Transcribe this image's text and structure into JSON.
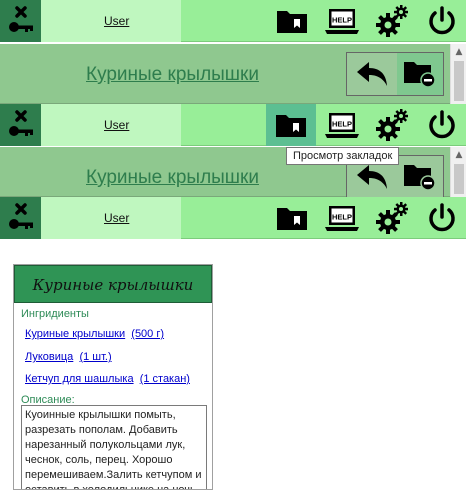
{
  "toolbar": {
    "user_label": "User",
    "active_button_color": "#5cbf92",
    "bookmarks_icon": "folder-bookmark-icon",
    "help_label": "HELP",
    "settings_icon": "gear-icon",
    "power_icon": "power-icon",
    "logout_icon": "key-x-icon"
  },
  "header": {
    "title": "Куриные крылышки",
    "back_icon": "back-arrow-icon",
    "remove_bookmark_icon": "folder-remove-icon"
  },
  "tooltip": {
    "text": "Просмотр закладок"
  },
  "recipe": {
    "title": "Куриные крылышки",
    "ingredients_label": "Ингридиенты",
    "ingredients": [
      {
        "name": "Куриные крылышки",
        "qty": "(500 г)"
      },
      {
        "name": "Луковица",
        "qty": "(1 шт.)"
      },
      {
        "name": "Кетчуп для шашлыка",
        "qty": "(1 стакан)"
      }
    ],
    "description_label": "Описание:",
    "description": "Куоинные крылышки помыть, разрезать пополам. Добавить нарезанный полукольцами лук, чеснок, соль, перец. Хорошо перемешиваем.Залить кетчупом и оставить в холодильнике на ночь. Выпекать в духовке"
  },
  "colors": {
    "toolbar_bg": "#98ee98",
    "header_bg": "#8fc88f",
    "title_green": "#2e7d4d",
    "card_title_bg": "#2f9455"
  }
}
